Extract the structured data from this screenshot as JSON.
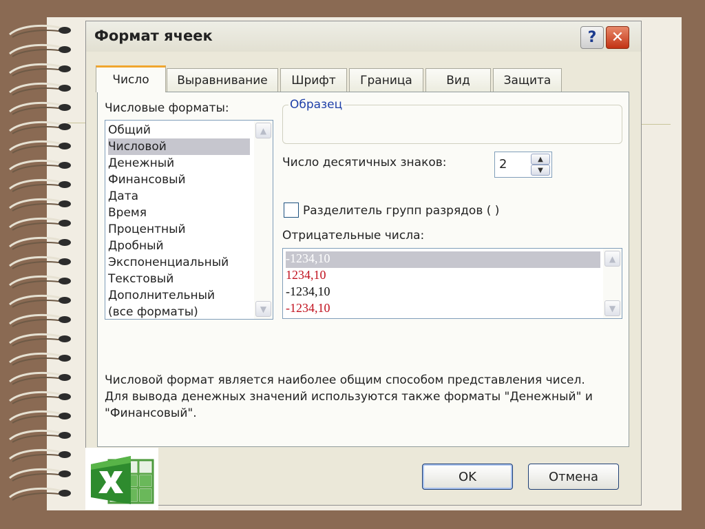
{
  "dialog": {
    "title": "Формат ячеек",
    "help_label": "?",
    "close_label": "✕"
  },
  "tabs": [
    {
      "label": "Число",
      "active": true
    },
    {
      "label": "Выравнивание",
      "active": false
    },
    {
      "label": "Шрифт",
      "active": false
    },
    {
      "label": "Граница",
      "active": false
    },
    {
      "label": "Вид",
      "active": false
    },
    {
      "label": "Защита",
      "active": false
    }
  ],
  "formats": {
    "label": "Числовые форматы:",
    "items": [
      "Общий",
      "Числовой",
      "Денежный",
      "Финансовый",
      "Дата",
      "Время",
      "Процентный",
      "Дробный",
      "Экспоненциальный",
      "Текстовый",
      "Дополнительный",
      "(все форматы)"
    ],
    "selected": "Числовой"
  },
  "sample": {
    "legend": "Образец",
    "value": ""
  },
  "decimals": {
    "label": "Число десятичных знаков:",
    "value": "2"
  },
  "separator": {
    "label": "Разделитель групп разрядов ( )",
    "checked": false
  },
  "negative": {
    "label": "Отрицательные числа:",
    "items": [
      {
        "text": "-1234,10",
        "color": "#ffffff",
        "selected": true
      },
      {
        "text": "1234,10",
        "color": "#c1121f",
        "selected": false
      },
      {
        "text": "-1234,10",
        "color": "#111111",
        "selected": false
      },
      {
        "text": "-1234,10",
        "color": "#c1121f",
        "selected": false
      }
    ]
  },
  "description": {
    "line1": "Числовой формат является наиболее общим способом представления чисел.",
    "line2": "Для вывода денежных значений используются также форматы \"Денежный\" и",
    "line3": "\"Финансовый\"."
  },
  "buttons": {
    "ok": "OK",
    "cancel": "Отмена"
  },
  "icons": {
    "logo": "excel-logo-icon",
    "spiral": "spiral-binding-icon"
  },
  "colors": {
    "selection": "#c6c6ce",
    "accent_tab": "#f0a62e",
    "negative_red": "#c1121f",
    "excel_green": "#2e8b2e"
  }
}
